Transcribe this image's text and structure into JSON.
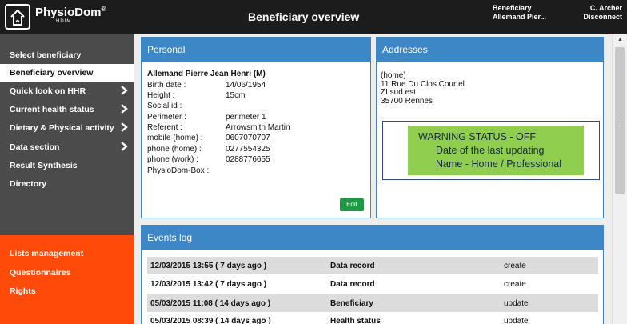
{
  "header": {
    "logo_text": "PhysioDom",
    "logo_mark": "®",
    "logo_sub": "HDIM",
    "title": "Beneficiary overview",
    "beneficiary_label": "Beneficiary",
    "beneficiary_name": "Allemand Pier...",
    "user_name": "C. Archer",
    "disconnect_label": "Disconnect"
  },
  "sidebar": {
    "items": [
      {
        "label": "Select beneficiary",
        "chevron": false,
        "active": false
      },
      {
        "label": "Beneficiary overview",
        "chevron": false,
        "active": true
      },
      {
        "label": "Quick look on HHR",
        "chevron": true,
        "active": false
      },
      {
        "label": "Current health status",
        "chevron": true,
        "active": false
      },
      {
        "label": "Dietary & Physical activity",
        "chevron": true,
        "active": false
      },
      {
        "label": "Data section",
        "chevron": true,
        "active": false
      },
      {
        "label": "Result Synthesis",
        "chevron": false,
        "active": false
      },
      {
        "label": "Directory",
        "chevron": false,
        "active": false
      }
    ],
    "admin_items": [
      {
        "label": "Lists management"
      },
      {
        "label": "Questionnaires"
      },
      {
        "label": "Rights"
      }
    ]
  },
  "personal": {
    "title": "Personal",
    "name": "Allemand Pierre Jean Henri (M)",
    "fields": [
      {
        "label": "Birth date :",
        "value": "14/06/1954"
      },
      {
        "label": "Height :",
        "value": "15cm"
      },
      {
        "label": "Social id :",
        "value": ""
      },
      {
        "label": "Perimeter :",
        "value": "perimeter 1"
      },
      {
        "label": "Referent :",
        "value": "Arrowsmith Martin"
      },
      {
        "label": "mobile (home) :",
        "value": "0607070707"
      },
      {
        "label": "phone (home) :",
        "value": "0277554325"
      },
      {
        "label": "phone (work) :",
        "value": "0288776655"
      },
      {
        "label": "PhysioDom-Box :",
        "value": ""
      }
    ],
    "edit_label": "Edit"
  },
  "addresses": {
    "title": "Addresses",
    "lines": [
      "(home)",
      "11 Rue Du Clos Courtel",
      "ZI sud est",
      "35700 Rennes"
    ],
    "warning": {
      "line1": "WARNING STATUS - OFF",
      "line2": "Date of the last updating",
      "line3": "Name - Home / Professional"
    }
  },
  "events": {
    "title": "Events log",
    "rows": [
      {
        "date": "12/03/2015 13:55 ( 7 days ago )",
        "type": "Data record",
        "action": "create"
      },
      {
        "date": "12/03/2015 13:42 ( 7 days ago )",
        "type": "Data record",
        "action": "create"
      },
      {
        "date": "05/03/2015 11:08 ( 14 days ago )",
        "type": "Beneficiary",
        "action": "update"
      },
      {
        "date": "05/03/2015 08:39 ( 14 days ago )",
        "type": "Health status",
        "action": "update"
      }
    ]
  },
  "colors": {
    "accent": "#3d87c6",
    "sidebar_dark": "#4b4b4b",
    "sidebar_orange": "#ff4a0a",
    "warning_green": "#8fce4f",
    "edit_green": "#1e9a45"
  }
}
